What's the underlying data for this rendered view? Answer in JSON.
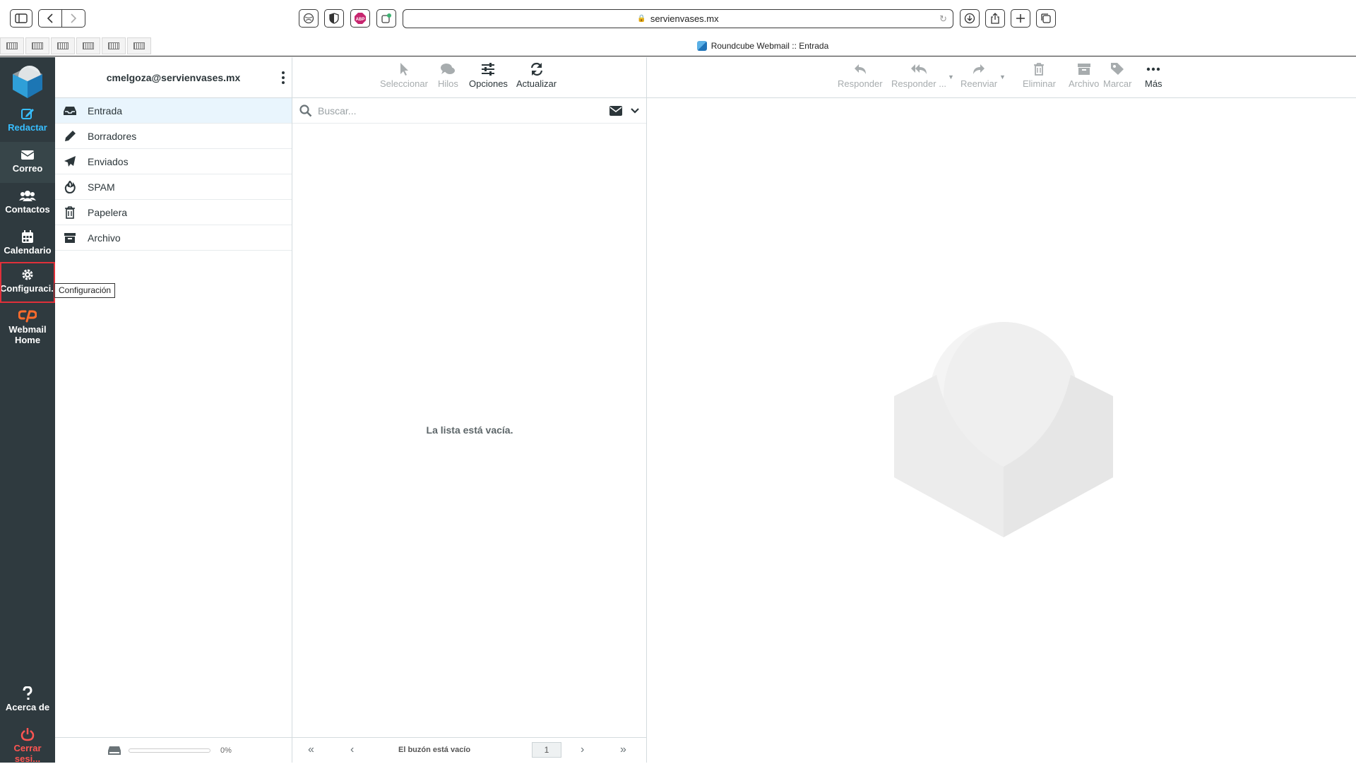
{
  "browser": {
    "url": "servienvases.mx",
    "tab_title": "Roundcube Webmail :: Entrada"
  },
  "nav": {
    "items": [
      {
        "label": "Redactar",
        "icon": "compose-icon"
      },
      {
        "label": "Correo",
        "icon": "envelope-icon"
      },
      {
        "label": "Contactos",
        "icon": "contacts-icon"
      },
      {
        "label": "Calendario",
        "icon": "calendar-icon"
      },
      {
        "label": "Configuraci...",
        "icon": "gear-icon"
      },
      {
        "label": "Webmail Home",
        "icon": "cpanel-icon"
      },
      {
        "label": "Acerca de",
        "icon": "question-icon"
      },
      {
        "label": "Cerrar sesi...",
        "icon": "power-icon"
      }
    ],
    "tooltip": "Configuración"
  },
  "folders": {
    "account": "cmelgoza@servienvases.mx",
    "items": [
      {
        "label": "Entrada",
        "icon": "inbox-icon"
      },
      {
        "label": "Borradores",
        "icon": "pencil-icon"
      },
      {
        "label": "Enviados",
        "icon": "paper-plane-icon"
      },
      {
        "label": "SPAM",
        "icon": "fire-icon"
      },
      {
        "label": "Papelera",
        "icon": "trash-icon"
      },
      {
        "label": "Archivo",
        "icon": "archive-icon"
      }
    ],
    "quota": {
      "text": "0%",
      "fraction": 0
    }
  },
  "list": {
    "toolbar": {
      "select": "Seleccionar",
      "threads": "Hilos",
      "options": "Opciones",
      "refresh": "Actualizar"
    },
    "search_placeholder": "Buscar...",
    "empty_message": "La lista está vacía.",
    "footer": {
      "count": "El buzón está vacío",
      "page": "1"
    }
  },
  "content": {
    "toolbar": {
      "reply": "Responder",
      "reply_all": "Responder ...",
      "forward": "Reenviar",
      "delete": "Eliminar",
      "archive": "Archivo",
      "mark": "Marcar",
      "more": "Más"
    }
  },
  "colors": {
    "nav_bg": "#2f3a3f",
    "accent": "#37beff",
    "logout": "#ff5552",
    "selected_folder": "#e9f5fd",
    "focus_outline": "#e0303a"
  }
}
